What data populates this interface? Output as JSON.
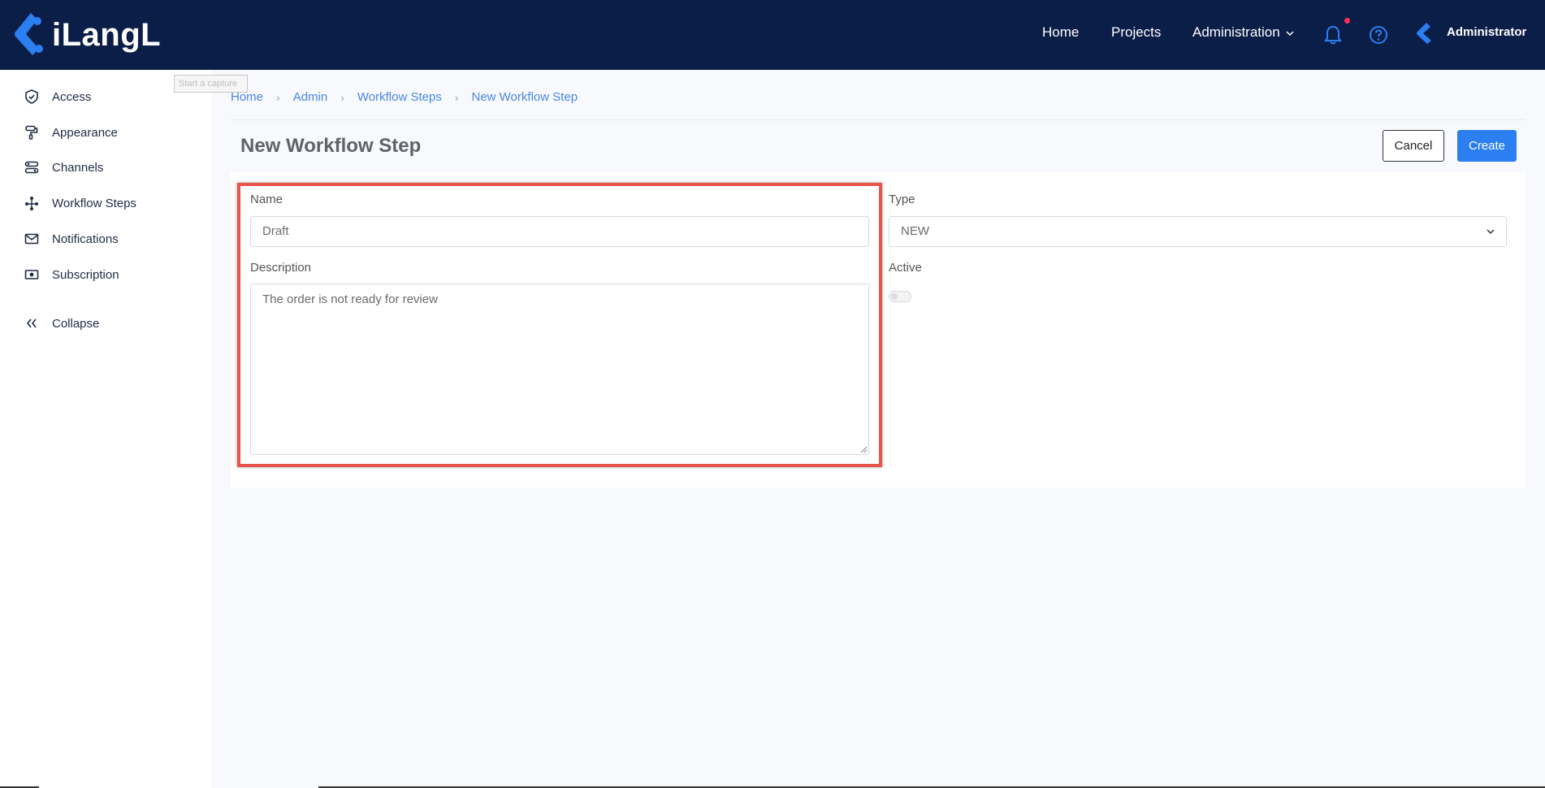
{
  "brand": {
    "name": "iLangL",
    "color": "#2b7ff0"
  },
  "nav": {
    "home": "Home",
    "projects": "Projects",
    "administration": "Administration",
    "user": "Administrator"
  },
  "sidebar": {
    "items": [
      {
        "label": "Access",
        "icon": "shield-check-icon"
      },
      {
        "label": "Appearance",
        "icon": "paint-roller-icon"
      },
      {
        "label": "Channels",
        "icon": "channels-icon"
      },
      {
        "label": "Workflow Steps",
        "icon": "workflow-icon"
      },
      {
        "label": "Notifications",
        "icon": "envelope-icon"
      },
      {
        "label": "Subscription",
        "icon": "money-icon"
      }
    ],
    "collapse": "Collapse"
  },
  "tooltip": "Start a capture",
  "breadcrumb": [
    "Home",
    "Admin",
    "Workflow Steps",
    "New Workflow Step"
  ],
  "page": {
    "title": "New Workflow Step",
    "cancel": "Cancel",
    "create": "Create"
  },
  "form": {
    "name_label": "Name",
    "name_value": "Draft",
    "description_label": "Description",
    "description_value": "The order is not ready for review",
    "type_label": "Type",
    "type_value": "NEW",
    "active_label": "Active",
    "active": false
  },
  "colors": {
    "topbar": "#0b1e48",
    "accent": "#2b7ff0",
    "highlight": "#e9534a"
  }
}
